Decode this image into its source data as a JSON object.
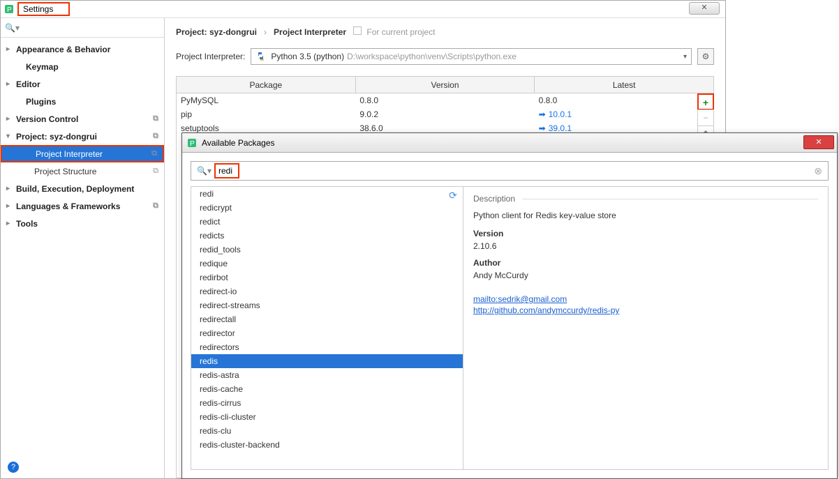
{
  "settings": {
    "title": "Settings",
    "close_label": "✕",
    "search_placeholder": ""
  },
  "sidebar": {
    "items": [
      {
        "label": "Appearance & Behavior",
        "type": "collapsed"
      },
      {
        "label": "Keymap",
        "type": "leaf"
      },
      {
        "label": "Editor",
        "type": "collapsed"
      },
      {
        "label": "Plugins",
        "type": "leaf"
      },
      {
        "label": "Version Control",
        "type": "collapsed",
        "copy": true
      },
      {
        "label": "Project: syz-dongrui",
        "type": "expanded",
        "copy": true
      },
      {
        "label": "Project Interpreter",
        "type": "child",
        "selected": true,
        "copy": true
      },
      {
        "label": "Project Structure",
        "type": "child",
        "copy": true
      },
      {
        "label": "Build, Execution, Deployment",
        "type": "collapsed"
      },
      {
        "label": "Languages & Frameworks",
        "type": "collapsed",
        "copy": true
      },
      {
        "label": "Tools",
        "type": "collapsed"
      }
    ]
  },
  "breadcrumb": {
    "project": "Project: syz-dongrui",
    "page": "Project Interpreter",
    "for_current": "For current project"
  },
  "interpreter": {
    "label": "Project Interpreter:",
    "name": "Python 3.5 (python)",
    "path": "D:\\workspace\\python\\venv\\Scripts\\python.exe"
  },
  "pkg_table": {
    "headers": [
      "Package",
      "Version",
      "Latest"
    ],
    "rows": [
      {
        "name": "PyMySQL",
        "version": "0.8.0",
        "latest": "0.8.0",
        "arrow": false
      },
      {
        "name": "pip",
        "version": "9.0.2",
        "latest": "10.0.1",
        "arrow": true
      },
      {
        "name": "setuptools",
        "version": "38.6.0",
        "latest": "39.0.1",
        "arrow": true
      }
    ]
  },
  "avail": {
    "title": "Available Packages",
    "search_term": "redi",
    "list": [
      "redi",
      "redicrypt",
      "redict",
      "redicts",
      "redid_tools",
      "redique",
      "redirbot",
      "redirect-io",
      "redirect-streams",
      "redirectall",
      "redirector",
      "redirectors",
      "redis",
      "redis-astra",
      "redis-cache",
      "redis-cirrus",
      "redis-cli-cluster",
      "redis-clu",
      "redis-cluster-backend"
    ],
    "selected_index": 12,
    "detail": {
      "section": "Description",
      "desc": "Python client for Redis key-value store",
      "version_label": "Version",
      "version": "2.10.6",
      "author_label": "Author",
      "author": "Andy McCurdy",
      "link1": "mailto:sedrik@gmail.com",
      "link2": "http://github.com/andymccurdy/redis-py"
    }
  }
}
